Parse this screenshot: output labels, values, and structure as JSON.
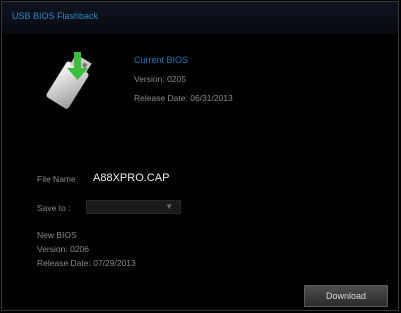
{
  "window": {
    "title": "USB BIOS Flashback"
  },
  "current": {
    "heading": "Current BIOS",
    "version": "Version: 0205",
    "release": "Release Date: 06/31/2013"
  },
  "file": {
    "label": "File Name",
    "value": "A88XPRO.CAP"
  },
  "save": {
    "label": "Save to :",
    "value": ""
  },
  "new_bios": {
    "heading": "New BIOS",
    "version": "Version: 0206",
    "release": "Release Date: 07/29/2013"
  },
  "actions": {
    "download_label": "Download"
  },
  "icons": {
    "usb": "usb-drive-download-icon",
    "dropdown": "chevron-down-icon"
  },
  "colors": {
    "accent": "#2a88c8",
    "arrow": "#3bbf3b",
    "background": "#000000"
  }
}
